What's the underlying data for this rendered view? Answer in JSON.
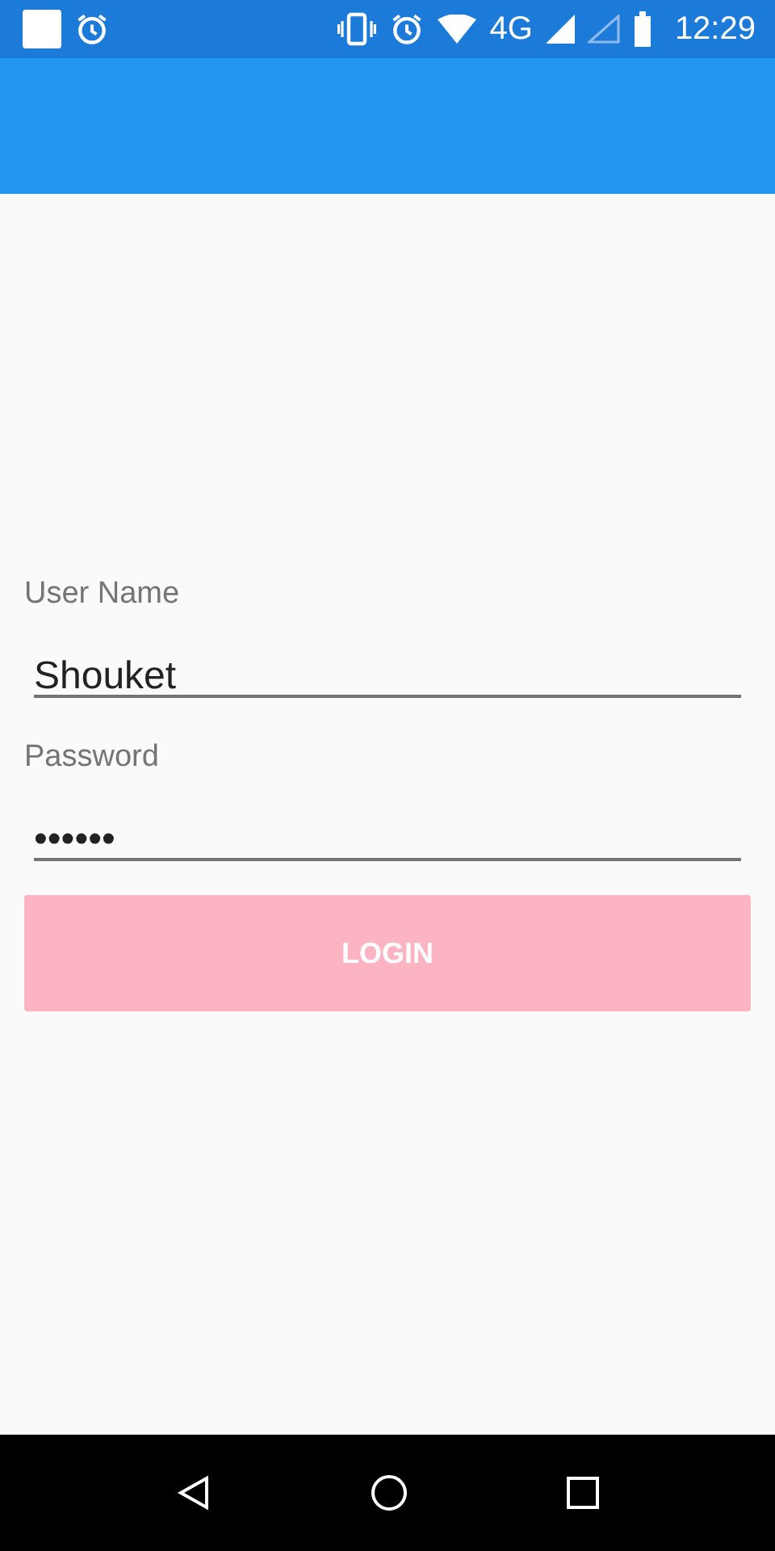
{
  "status_bar": {
    "network": "4G",
    "time": "12:29"
  },
  "form": {
    "fields": [
      {
        "label": "User Name",
        "value": "Shouket"
      },
      {
        "label": "Password",
        "value": "••••••"
      }
    ],
    "button": {
      "label": "LOGIN",
      "disabled": true
    }
  }
}
